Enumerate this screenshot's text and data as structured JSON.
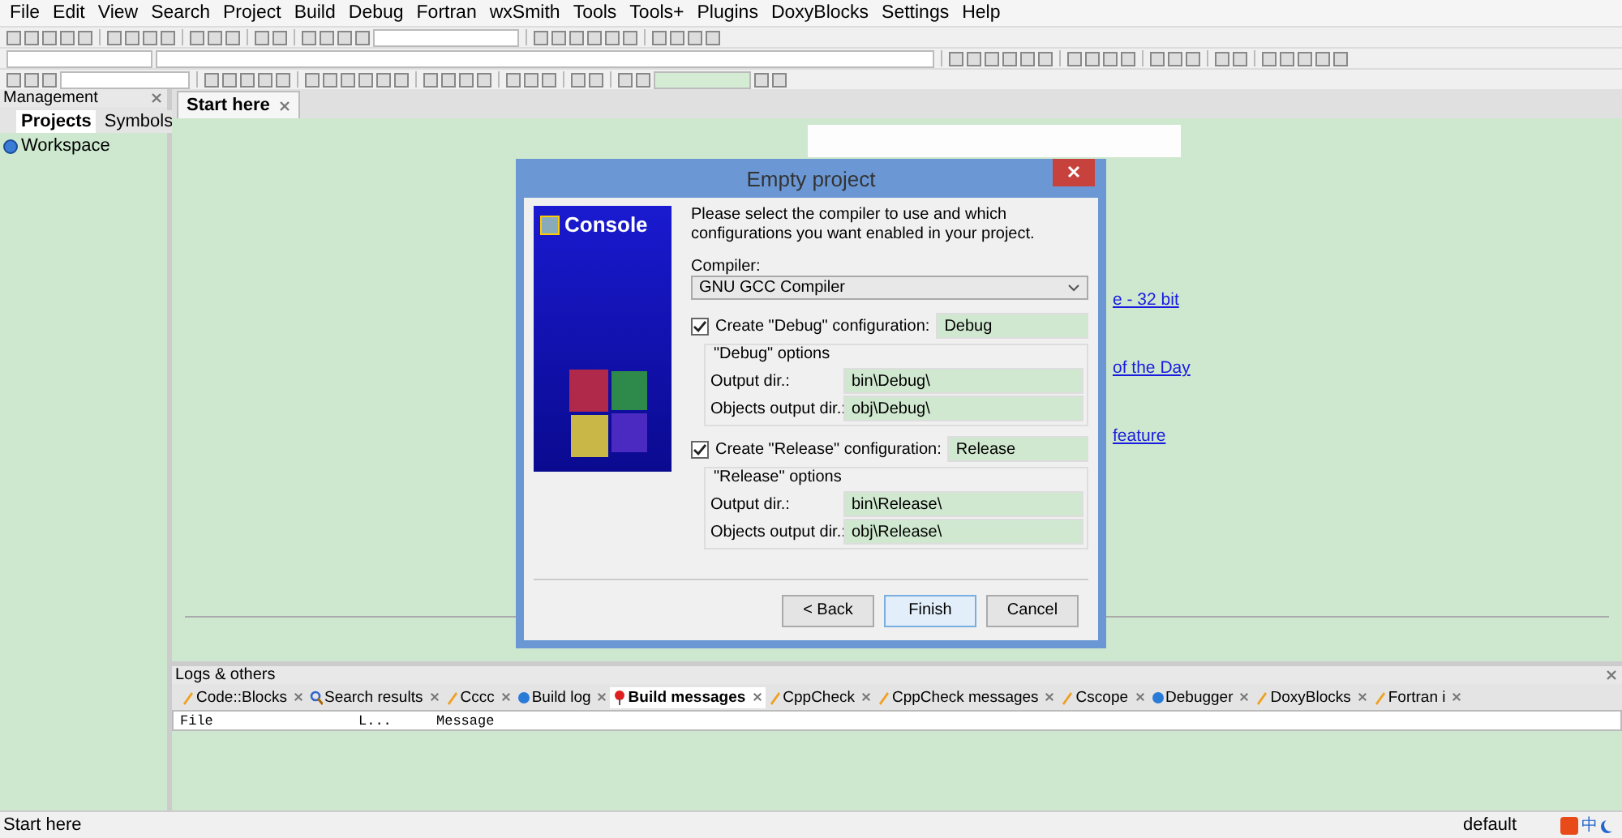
{
  "menu": [
    "File",
    "Edit",
    "View",
    "Search",
    "Project",
    "Build",
    "Debug",
    "Fortran",
    "wxSmith",
    "Tools",
    "Tools+",
    "Plugins",
    "DoxyBlocks",
    "Settings",
    "Help"
  ],
  "management": {
    "title": "Management",
    "tabs": [
      {
        "label": "Projects",
        "selected": true
      },
      {
        "label": "Symbols",
        "selected": false
      }
    ],
    "tree": [
      {
        "label": "Workspace"
      }
    ]
  },
  "editor": {
    "tabs": [
      {
        "label": "Start here",
        "selected": true
      }
    ],
    "links": [
      "e - 32 bit",
      "of the Day",
      "feature"
    ]
  },
  "dialog": {
    "title": "Empty project",
    "banner": "Console",
    "intro": "Please select the compiler to use and which configurations you want enabled in your project.",
    "compiler_label": "Compiler:",
    "compiler": "GNU GCC Compiler",
    "configs": [
      {
        "label": "Create \"Debug\" configuration:",
        "checked": true,
        "name": "Debug",
        "options_title": "\"Debug\" options",
        "output_label": "Output dir.:",
        "output": "bin\\Debug\\",
        "objects_label": "Objects output dir.:",
        "objects": "obj\\Debug\\"
      },
      {
        "label": "Create \"Release\" configuration:",
        "checked": true,
        "name": "Release",
        "options_title": "\"Release\" options",
        "output_label": "Output dir.:",
        "output": "bin\\Release\\",
        "objects_label": "Objects output dir.:",
        "objects": "obj\\Release\\"
      }
    ],
    "buttons": [
      {
        "label": "< Back",
        "selected": false
      },
      {
        "label": "Finish",
        "selected": true
      },
      {
        "label": "Cancel",
        "selected": false
      }
    ]
  },
  "logs": {
    "title": "Logs & others",
    "tabs": [
      {
        "label": "Code::Blocks",
        "kind": "pencil",
        "selected": false
      },
      {
        "label": "Search results",
        "kind": "search",
        "selected": false
      },
      {
        "label": "Cccc",
        "kind": "pencil",
        "selected": false
      },
      {
        "label": "Build log",
        "kind": "circle",
        "selected": false
      },
      {
        "label": "Build messages",
        "kind": "pin",
        "selected": true
      },
      {
        "label": "CppCheck",
        "kind": "pencil",
        "selected": false
      },
      {
        "label": "CppCheck messages",
        "kind": "pencil",
        "selected": false
      },
      {
        "label": "Cscope",
        "kind": "pencil",
        "selected": false
      },
      {
        "label": "Debugger",
        "kind": "circle",
        "selected": false
      },
      {
        "label": "DoxyBlocks",
        "kind": "pencil",
        "selected": false
      },
      {
        "label": "Fortran i",
        "kind": "pencil",
        "selected": false
      }
    ],
    "columns": [
      "File",
      "L...",
      "Message"
    ]
  },
  "status_bar": {
    "text": "Start here",
    "mode": "default",
    "ime": "中"
  }
}
